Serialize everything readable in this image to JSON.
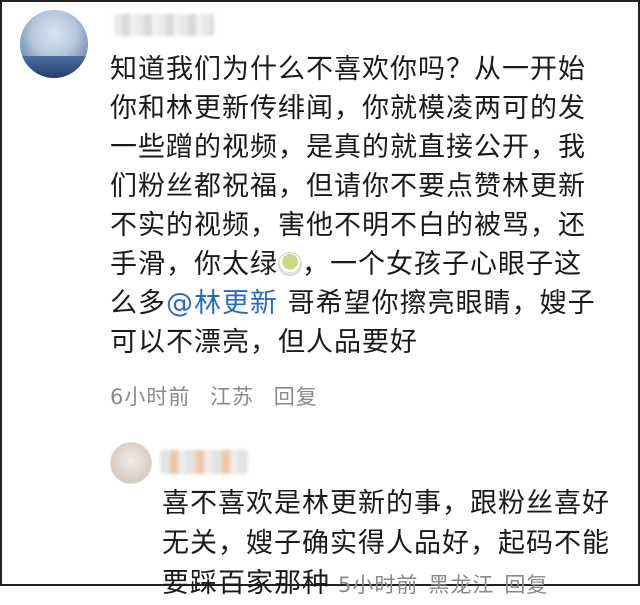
{
  "comment": {
    "lines": [
      "知道我们为什么不喜欢你吗？从一开始",
      "你和林更新传绯闻，你就模凌两可的发",
      "一些蹭的视频，是真的就直接公开，我",
      "们粉丝都祝福，但请你不要点赞林更新",
      "不实的视频，害他不明不白的被骂，还"
    ],
    "line6_before": "手滑，你太绿",
    "line6_after": "，一个女孩子心眼子这",
    "line7_before": "么多",
    "mention": "@林更新",
    "line7_after": " 哥希望你擦亮眼睛，嫂子",
    "line8": "可以不漂亮，但人品要好",
    "time": "6小时前",
    "location": "江苏",
    "reply_label": "回复",
    "emoji_icon": "green-tea-icon"
  },
  "reply": {
    "lines": [
      "喜不喜欢是林更新的事，跟粉丝喜好",
      "无关，嫂子确实得人品好，起码不能"
    ],
    "line3": "要踩百家那种",
    "time": "5小时前",
    "location": "黑龙江",
    "reply_label": "回复"
  }
}
